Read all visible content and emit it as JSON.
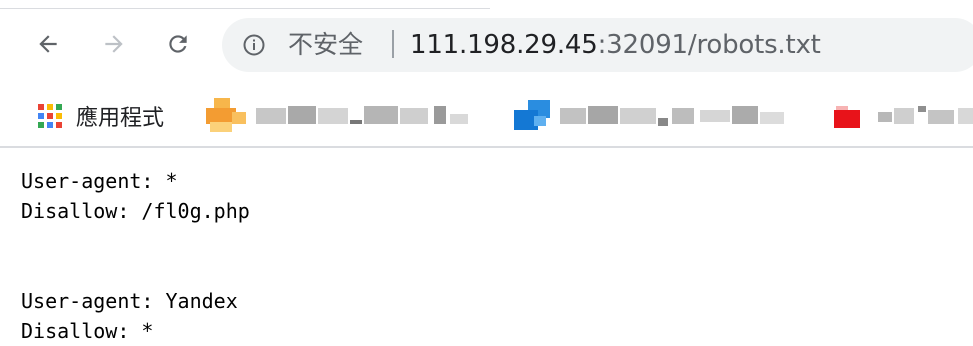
{
  "browser": {
    "nav": {
      "back_icon": "arrow-left-icon",
      "forward_icon": "arrow-right-icon",
      "reload_icon": "reload-icon"
    },
    "omnibox": {
      "info_icon": "info-icon",
      "security_label": "不安全",
      "url_host": "111.198.29.45",
      "url_rest": ":32091/robots.txt"
    },
    "bookmarks": {
      "apps_label": "應用程式",
      "apps_icon": "apps-grid-icon",
      "items": [
        {
          "icon": "orange-favicon"
        },
        {
          "icon": "blue-favicon"
        },
        {
          "icon": "red-favicon"
        }
      ]
    }
  },
  "page": {
    "lines": [
      "User-agent: *",
      "Disallow: /fl0g.php",
      "",
      "",
      "User-agent: Yandex",
      "Disallow: *"
    ]
  },
  "colors": {
    "omnibox_bg": "#f1f3f4",
    "url_host": "#202124",
    "url_rest": "#5f6368",
    "text": "#000000"
  }
}
